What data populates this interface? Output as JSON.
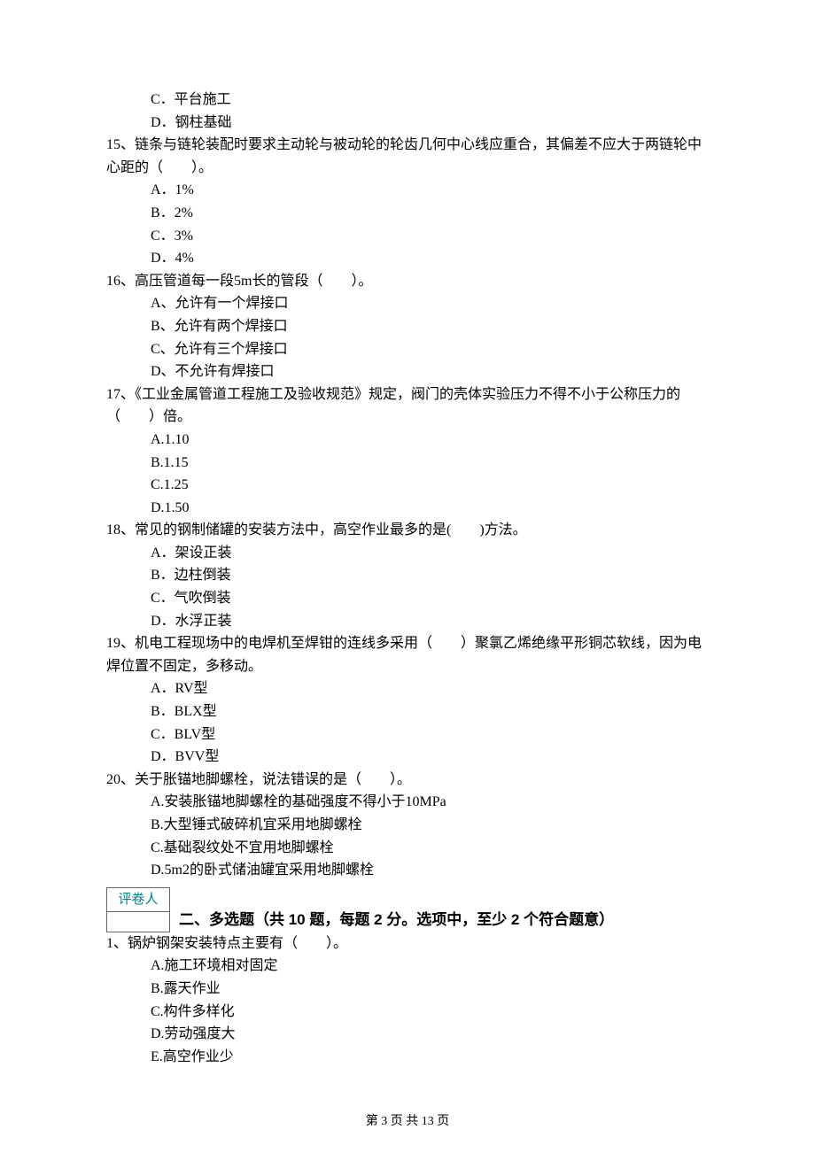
{
  "q14": {
    "c": "C．平台施工",
    "d": "D．钢柱基础"
  },
  "q15": {
    "stem": "15、链条与链轮装配时要求主动轮与被动轮的轮齿几何中心线应重合，其偏差不应大于两链轮中心距的（　　）。",
    "a": "A．1%",
    "b": "B．2%",
    "c": "C．3%",
    "d": "D．4%"
  },
  "q16": {
    "stem": "16、高压管道每一段5m长的管段（　　）。",
    "a": "A、允许有一个焊接口",
    "b": "B、允许有两个焊接口",
    "c": "C、允许有三个焊接口",
    "d": "D、不允许有焊接口"
  },
  "q17": {
    "stem": "17、《工业金属管道工程施工及验收规范》规定，阀门的壳体实验压力不得不小于公称压力的（　　）倍。",
    "a": "A.1.10",
    "b": "B.1.15",
    "c": "C.1.25",
    "d": "D.1.50"
  },
  "q18": {
    "stem": "18、常见的钢制储罐的安装方法中，高空作业最多的是(　　)方法。",
    "a": "A．架设正装",
    "b": "B．边柱倒装",
    "c": "C．气吹倒装",
    "d": "D．水浮正装"
  },
  "q19": {
    "stem": "19、机电工程现场中的电焊机至焊钳的连线多采用（　　）聚氯乙烯绝缘平形铜芯软线，因为电焊位置不固定，多移动。",
    "a": "A．RV型",
    "b": "B．BLX型",
    "c": "C．BLV型",
    "d": "D．BVV型"
  },
  "q20": {
    "stem": "20、关于胀锚地脚螺栓，说法错误的是（　　）。",
    "a": "A.安装胀锚地脚螺栓的基础强度不得小于10MPa",
    "b": "B.大型锤式破碎机宜采用地脚螺栓",
    "c": "C.基础裂纹处不宜用地脚螺栓",
    "d": "D.5m2的卧式储油罐宜采用地脚螺栓"
  },
  "grader": "评卷人",
  "section2": "二、多选题（共 10 题，每题 2 分。选项中，至少 2 个符合题意）",
  "mq1": {
    "stem": "1、锅炉钢架安装特点主要有（　　）。",
    "a": "A.施工环境相对固定",
    "b": "B.露天作业",
    "c": "C.构件多样化",
    "d": "D.劳动强度大",
    "e": "E.高空作业少"
  },
  "footer": "第 3 页 共 13 页"
}
